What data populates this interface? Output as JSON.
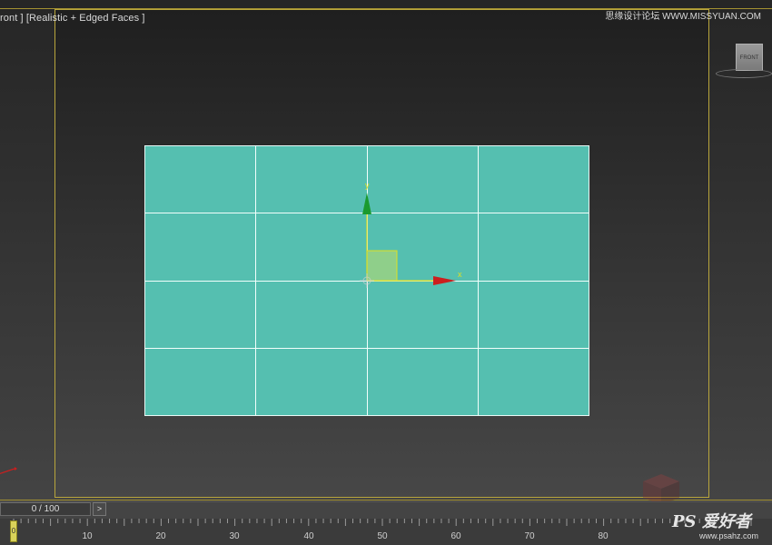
{
  "viewport": {
    "label": "ront ] [Realistic + Edged Faces ]",
    "watermark": "思缘设计论坛 WWW.MISSYUAN.COM",
    "viewcube_label": "FRONT"
  },
  "gizmo": {
    "x_label": "x",
    "y_label": "y"
  },
  "timeline": {
    "slider_value": "0 / 100",
    "next_label": ">",
    "current_frame": "0",
    "ticks": [
      "10",
      "20",
      "30",
      "40",
      "50",
      "60",
      "70",
      "80"
    ]
  },
  "watermark_bottom": {
    "brand": "PS 爱好者",
    "url": "www.psahz.com"
  },
  "colors": {
    "plane": "#55bfb0",
    "grid_lines": "#f2fffc",
    "frame": "#b9a63c",
    "x_axis": "#cc1e1e",
    "y_axis": "#1a9a2e",
    "gizmo_lines": "#e0e020"
  }
}
